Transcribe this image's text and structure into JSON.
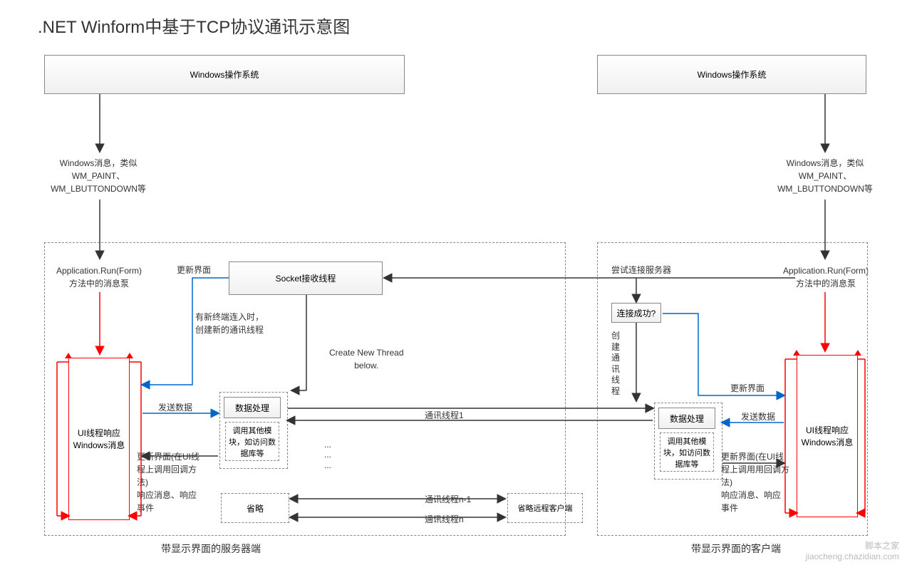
{
  "title": ".NET Winform中基于TCP协议通讯示意图",
  "os_left": "Windows操作系统",
  "os_right": "Windows操作系统",
  "winmsg_left": "Windows消息，类似\nWM_PAINT、\nWM_LBUTTONDOWN等",
  "winmsg_right": "Windows消息，类似\nWM_PAINT、\nWM_LBUTTONDOWN等",
  "apprun_left": "Application.Run(Form)\n方法中的消息泵",
  "apprun_right": "Application.Run(Form)\n方法中的消息泵",
  "ui_thread_left": "UI线程响应\nWindows消息",
  "ui_thread_right": "UI线程响应\nWindows消息",
  "update_ui": "更新界面",
  "update_ui_right": "更新界面",
  "socket_thread": "Socket接收线程",
  "new_terminal": "有新终端连入时，\n创建新的通讯线程",
  "create_thread": "Create New Thread\nbelow.",
  "send_data": "发送数据",
  "send_data_right": "发送数据",
  "data_process": "数据处理",
  "data_process_right": "数据处理",
  "call_other": "调用其他模\n块，如访问数\n据库等",
  "call_other_right": "调用其他模\n块，如访问数\n据库等",
  "update_callback": "更新界面(在UI线\n程上调用回调方\n法)\n响应消息、响应\n事件",
  "update_callback_right": "更新界面(在UI线\n程上调用用回调方\n法)\n响应消息、响应\n事件",
  "ellipsis": "...\n...\n...",
  "omit": "省略",
  "comm1": "通讯线程1",
  "comm_n1": "通讯线程n-1",
  "comm_n": "通讯线程n",
  "omit_remote": "省略远程客户端",
  "try_connect": "尝试连接服务器",
  "connect_ok": "连接成功?",
  "create_comm_thread": "创\n建\n通\n讯\n线\n程",
  "footer_left": "带显示界面的服务器端",
  "footer_right": "带显示界面的客户端",
  "watermark": "脚本之家\njiaocheng.chazidian.com"
}
